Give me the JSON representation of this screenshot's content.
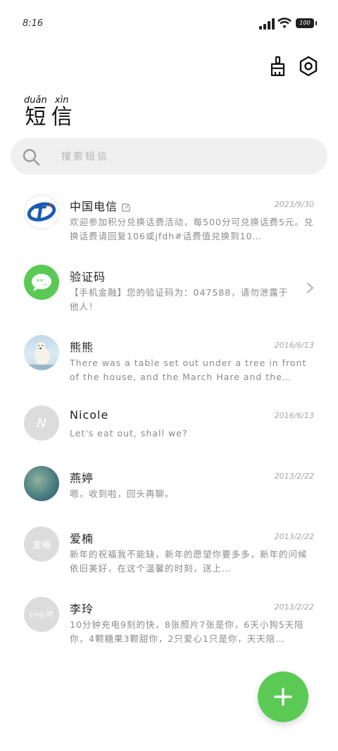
{
  "status_bar": {
    "time": "8:16",
    "battery": "100"
  },
  "toolbar": {
    "clean_icon": "broom-icon",
    "settings_icon": "settings-hexagon-icon"
  },
  "title": {
    "chars": [
      {
        "pinyin": "duǎn",
        "hanzi": "短"
      },
      {
        "pinyin": "xìn",
        "hanzi": "信"
      }
    ]
  },
  "search": {
    "placeholder": "搜索短信"
  },
  "conversations": [
    {
      "name": "中国电信",
      "date": "2023/9/30",
      "preview": "欢迎参加积分兑换话费活动，每500分可兑换话费5元。兑换话费请回复106或jfdh#话费值兑换到10…",
      "avatar": "china-telecom-logo",
      "avatar_text": ""
    },
    {
      "name": "验证码",
      "date": "",
      "preview": "【手机金融】您的验证码为：047588，请勿泄露于他人！",
      "avatar": "message-bubble-icon",
      "avatar_text": ""
    },
    {
      "name": "熊熊",
      "date": "2016/6/13",
      "preview": "There was a table set out under a tree in front of the house, and the March Hare and the Hatter were…",
      "avatar": "polar-bear-photo",
      "avatar_text": ""
    },
    {
      "name": "Nicole",
      "date": "2016/6/13",
      "preview": "Let's eat out, shall we?",
      "avatar": "initial-avatar",
      "avatar_text": "N"
    },
    {
      "name": "燕婷",
      "date": "2013/2/22",
      "preview": "嗯，收到啦，回头再聊。",
      "avatar": "landscape-photo",
      "avatar_text": ""
    },
    {
      "name": "爱楠",
      "date": "2013/2/22",
      "preview": "新年的祝福我不能缺，新年的愿望你要多多，新年的问候依旧美好，在这个温馨的时刻，送上…",
      "avatar": "initial-avatar",
      "avatar_text": "爱楠"
    },
    {
      "name": "李玲",
      "date": "2013/2/22",
      "preview": "10分钟充电9刻的快，8张照片7张是你，6天小狗5天陪你，4颗糖果3颗甜你，2只爱心1只是你，天天陪…",
      "avatar": "initial-avatar",
      "avatar_text": "Ling 玲"
    }
  ],
  "fab": {
    "icon": "plus-icon"
  },
  "colors": {
    "fab": "#5bca55",
    "telecom_blue": "#1b5bb5",
    "telecom_red": "#e23728",
    "message_green": "#5bca55"
  }
}
